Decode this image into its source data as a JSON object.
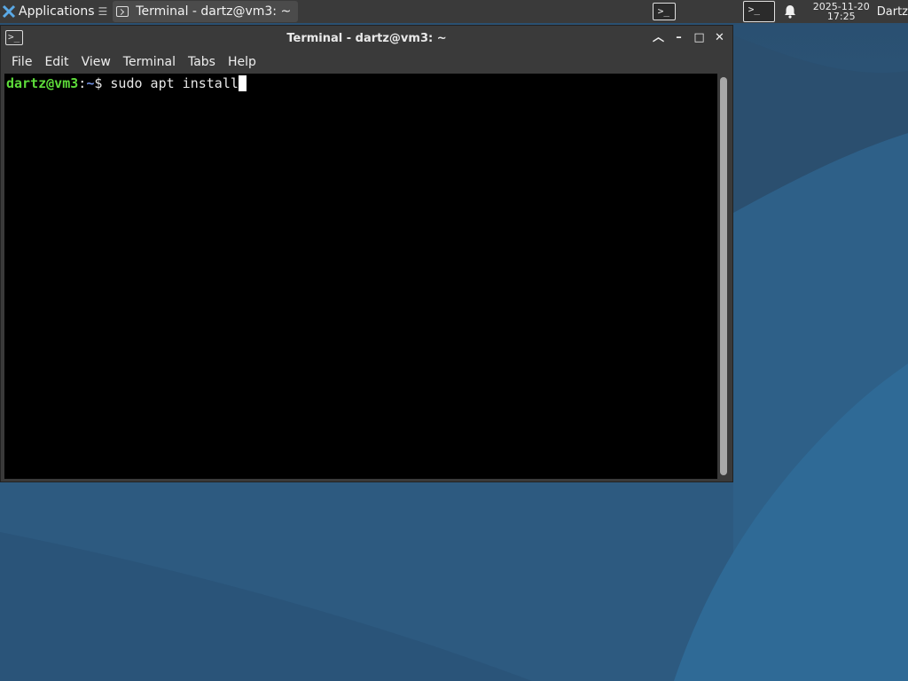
{
  "panel": {
    "applications_label": "Applications",
    "applications_extra": "☰",
    "task_title": "Terminal - dartz@vm3: ~",
    "clock_date": "2025-11-20",
    "clock_time": "17:25",
    "user_label": "Dartz",
    "icons": [
      "xfce-logo-icon",
      "terminal-icon",
      "terminal-tray-icon",
      "notification-bell-icon"
    ]
  },
  "window": {
    "title": "Terminal - dartz@vm3: ~",
    "controls": [
      "shade-icon",
      "minimize-icon",
      "maximize-icon",
      "close-icon"
    ],
    "menu": [
      "File",
      "Edit",
      "View",
      "Terminal",
      "Tabs",
      "Help"
    ]
  },
  "terminal": {
    "prompt_user": "dartz@vm3",
    "prompt_sep": ":",
    "prompt_path": "~",
    "prompt_symbol": "$ ",
    "command": "sudo apt install"
  },
  "colors": {
    "prompt_user": "#5ddb3a",
    "prompt_path": "#6f8fe0",
    "terminal_bg": "#000000",
    "panel_bg": "#3a3a3a"
  }
}
